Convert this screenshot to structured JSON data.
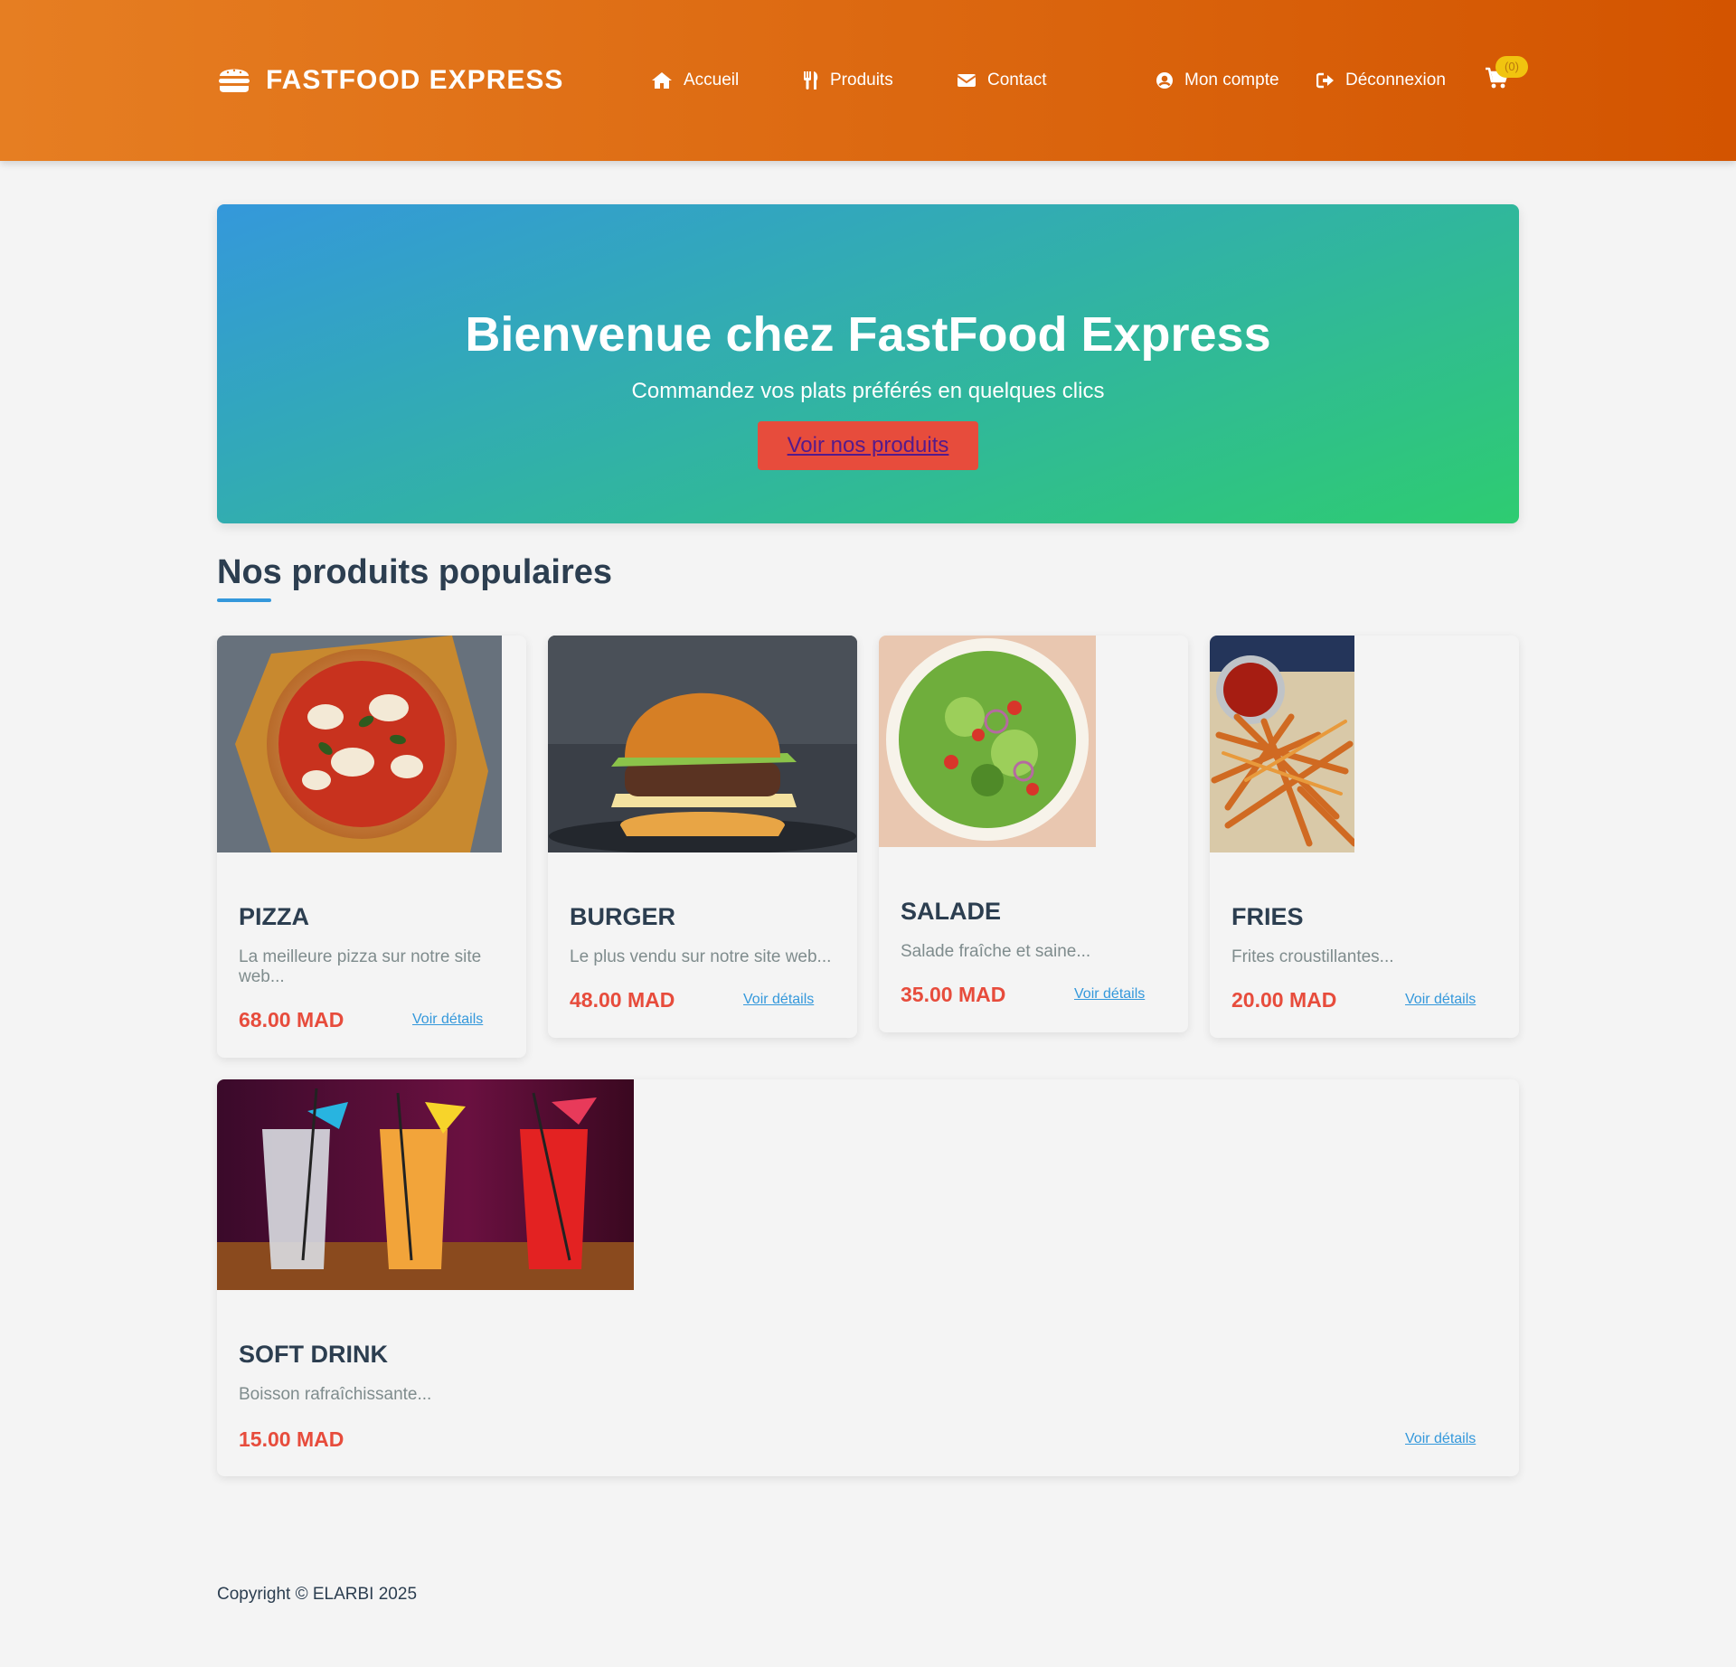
{
  "colors": {
    "header_start": "#e67e22",
    "header_end": "#d35400",
    "hero_start": "#3498db",
    "hero_end": "#2ecc71",
    "accent_red": "#e74c3c",
    "link_blue": "#3498db",
    "badge_yellow": "#f1c40f"
  },
  "header": {
    "brand": "FASTFOOD EXPRESS",
    "brand_icon": "burger-icon",
    "nav": [
      {
        "label": "Accueil",
        "icon": "home-icon"
      },
      {
        "label": "Produits",
        "icon": "utensils-icon"
      },
      {
        "label": "Contact",
        "icon": "envelope-icon"
      },
      {
        "label": "Mon compte",
        "icon": "user-circle-icon"
      },
      {
        "label": "Déconnexion",
        "icon": "sign-out-icon"
      }
    ],
    "cart_icon": "cart-icon",
    "cart_count": "(0)"
  },
  "hero": {
    "title": "Bienvenue chez FastFood Express",
    "subtitle": "Commandez vos plats préférés en quelques clics",
    "cta": "Voir nos produits"
  },
  "section": {
    "title": "Nos produits populaires"
  },
  "products": [
    {
      "name": "PIZZA",
      "description": "La meilleure pizza sur notre site web...",
      "price": "68.00 MAD",
      "link": "Voir détails",
      "image": "pizza-photo"
    },
    {
      "name": "BURGER",
      "description": "Le plus vendu sur notre site web...",
      "price": "48.00 MAD",
      "link": "Voir détails",
      "image": "burger-photo"
    },
    {
      "name": "SALADE",
      "description": "Salade fraîche et saine...",
      "price": "35.00 MAD",
      "link": "Voir détails",
      "image": "salad-photo"
    },
    {
      "name": "FRIES",
      "description": "Frites croustillantes...",
      "price": "20.00 MAD",
      "link": "Voir détails",
      "image": "fries-photo"
    },
    {
      "name": "SOFT DRINK",
      "description": "Boisson rafraîchissante...",
      "price": "15.00 MAD",
      "link": "Voir détails",
      "image": "drinks-photo"
    }
  ],
  "footer": {
    "copyright": "Copyright © ELARBI 2025"
  }
}
